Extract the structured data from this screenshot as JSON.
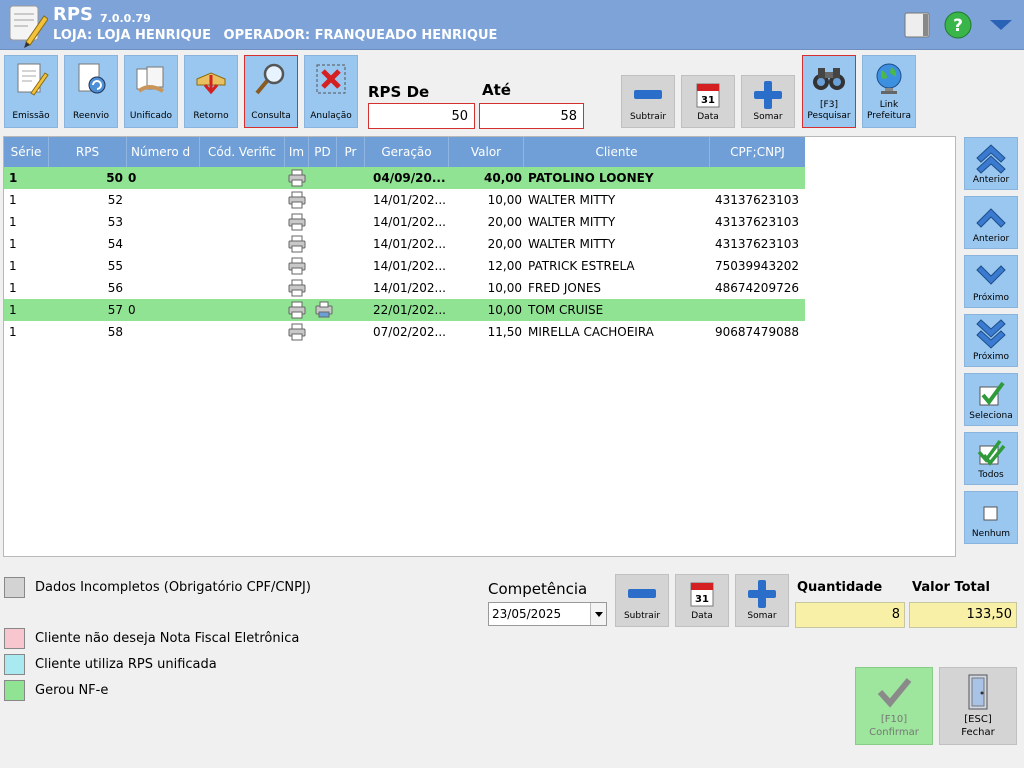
{
  "header": {
    "app_name": "RPS",
    "version": "7.0.0.79",
    "loja": "LOJA: LOJA HENRIQUE",
    "operador": "OPERADOR: FRANQUEADO HENRIQUE"
  },
  "toolbar": {
    "emissao": "Emissão",
    "reenvio": "Reenvio",
    "unificado": "Unificado",
    "retorno": "Retorno",
    "consulta": "Consulta",
    "anulacao": "Anulação"
  },
  "filter": {
    "rps_de_label": "RPS De",
    "rps_de_value": "50",
    "ate_label": "Até",
    "ate_value": "58",
    "subtrair": "Subtrair",
    "data": "Data",
    "somar": "Somar",
    "pesquisar_key": "[F3]",
    "pesquisar": "Pesquisar",
    "link_line1": "Link",
    "link_line2": "Prefeitura"
  },
  "table": {
    "columns": [
      "Série",
      "RPS",
      "Número d",
      "Cód. Verific",
      "Im",
      "PD",
      "Pr",
      "Geração",
      "Valor",
      "Cliente",
      "CPF;CNPJ"
    ],
    "rows": [
      {
        "serie": "1",
        "rps": "50",
        "numero": "0",
        "geracao": "04/09/20...",
        "valor": "40,00",
        "cliente": "PATOLINO LOONEY",
        "cpf": "",
        "green": true,
        "bold": true,
        "pd": false
      },
      {
        "serie": "1",
        "rps": "52",
        "numero": "",
        "geracao": "14/01/202...",
        "valor": "10,00",
        "cliente": "WALTER MITTY",
        "cpf": "43137623103",
        "green": false,
        "bold": false,
        "pd": false
      },
      {
        "serie": "1",
        "rps": "53",
        "numero": "",
        "geracao": "14/01/202...",
        "valor": "20,00",
        "cliente": "WALTER MITTY",
        "cpf": "43137623103",
        "green": false,
        "bold": false,
        "pd": false
      },
      {
        "serie": "1",
        "rps": "54",
        "numero": "",
        "geracao": "14/01/202...",
        "valor": "20,00",
        "cliente": "WALTER MITTY",
        "cpf": "43137623103",
        "green": false,
        "bold": false,
        "pd": false
      },
      {
        "serie": "1",
        "rps": "55",
        "numero": "",
        "geracao": "14/01/202...",
        "valor": "12,00",
        "cliente": "PATRICK ESTRELA",
        "cpf": "75039943202",
        "green": false,
        "bold": false,
        "pd": false
      },
      {
        "serie": "1",
        "rps": "56",
        "numero": "",
        "geracao": "14/01/202...",
        "valor": "10,00",
        "cliente": "FRED JONES",
        "cpf": "48674209726",
        "green": false,
        "bold": false,
        "pd": false
      },
      {
        "serie": "1",
        "rps": "57",
        "numero": "0",
        "geracao": "22/01/202...",
        "valor": "10,00",
        "cliente": "TOM CRUISE",
        "cpf": "",
        "green": true,
        "bold": false,
        "pd": true
      },
      {
        "serie": "1",
        "rps": "58",
        "numero": "",
        "geracao": "07/02/202...",
        "valor": "11,50",
        "cliente": "MIRELLA CACHOEIRA",
        "cpf": "90687479088",
        "green": false,
        "bold": false,
        "pd": false
      }
    ]
  },
  "nav": {
    "anterior_first": "Anterior",
    "anterior": "Anterior",
    "proximo": "Próximo",
    "proximo_last": "Próximo",
    "seleciona": "Seleciona",
    "todos": "Todos",
    "nenhum": "Nenhum"
  },
  "legend": {
    "incompletos": "Dados Incompletos (Obrigatório CPF/CNPJ)",
    "nao_deseja": "Cliente não deseja Nota Fiscal Eletrônica",
    "unificada": "Cliente utiliza RPS unificada",
    "gerou": "Gerou NF-e"
  },
  "footer": {
    "competencia_label": "Competência",
    "competencia_value": "23/05/2025",
    "subtrair": "Subtrair",
    "data": "Data",
    "somar": "Somar",
    "quantidade_label": "Quantidade",
    "quantidade_value": "8",
    "valor_total_label": "Valor Total",
    "valor_total_value": "133,50",
    "confirmar_key": "[F10]",
    "confirmar": "Confirmar",
    "fechar_key": "[ESC]",
    "fechar": "Fechar"
  },
  "colors": {
    "header": "#7ea3d8",
    "toolbar_button": "#99c7f0",
    "grid_header": "#6f9fd6",
    "gerou_nfe": "#8fe393",
    "incompletos": "#d3d3d3",
    "nao_deseja": "#f7c6cf",
    "unificada": "#a8eaf0"
  }
}
